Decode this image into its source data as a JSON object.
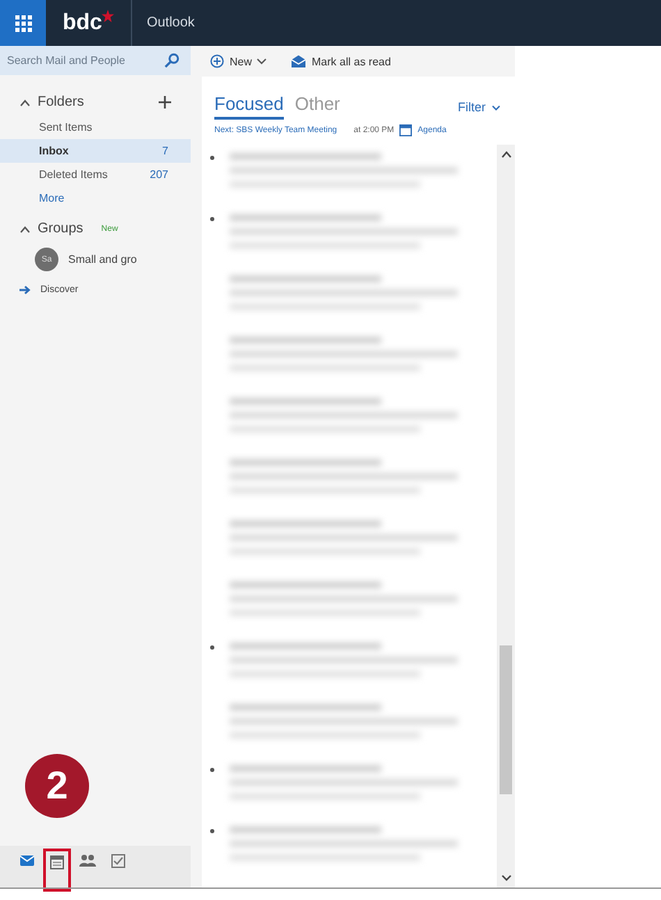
{
  "topbar": {
    "logo": "bdc",
    "app": "Outlook"
  },
  "search": {
    "placeholder": "Search Mail and People"
  },
  "folders": {
    "title": "Folders",
    "expanded": true,
    "items": [
      {
        "label": "Sent Items",
        "selected": false
      },
      {
        "label": "Inbox",
        "count": "7",
        "selected": true
      },
      {
        "label": "Deleted Items",
        "count": "207",
        "selected": false
      }
    ],
    "more": "More"
  },
  "groups": {
    "title": "Groups",
    "expanded": true,
    "badge": "New",
    "items": [
      {
        "initials": "Sa",
        "label": "Small and gro"
      }
    ],
    "discover": "Discover"
  },
  "annotation": {
    "number": "2"
  },
  "bottom_nav": [
    {
      "kind": "mail",
      "selected": true,
      "highlighted": false
    },
    {
      "kind": "calendar",
      "selected": false,
      "highlighted": true
    },
    {
      "kind": "people",
      "selected": false,
      "highlighted": false
    },
    {
      "kind": "tasks",
      "selected": false,
      "highlighted": false
    }
  ],
  "toolbar": {
    "new": "New",
    "mark_all": "Mark all as read"
  },
  "tabs": [
    {
      "label": "Focused",
      "selected": true
    },
    {
      "label": "Other",
      "selected": false
    }
  ],
  "filter": "Filter",
  "next": {
    "title": "Next: SBS Weekly Team Meeting",
    "time": "at 2:00 PM",
    "agenda": "Agenda"
  },
  "messages": [
    {
      "kind": "blurred",
      "unread": true
    },
    {
      "kind": "blurred",
      "unread": true
    },
    {
      "kind": "blurred",
      "unread": false
    },
    {
      "kind": "blurred",
      "unread": false
    },
    {
      "kind": "blurred",
      "unread": false
    },
    {
      "kind": "blurred",
      "unread": false
    },
    {
      "kind": "blurred",
      "unread": false
    },
    {
      "kind": "blurred",
      "unread": false
    },
    {
      "kind": "blurred",
      "unread": true
    },
    {
      "kind": "blurred",
      "unread": false
    },
    {
      "kind": "blurred",
      "unread": true
    },
    {
      "kind": "blurred",
      "unread": true
    }
  ]
}
